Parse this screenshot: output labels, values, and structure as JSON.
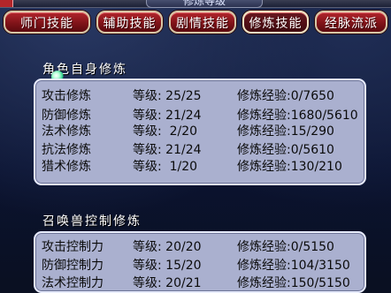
{
  "window": {
    "title": "修炼等级"
  },
  "tabs": [
    {
      "label": "师门技能",
      "active": false
    },
    {
      "label": "辅助技能",
      "active": false
    },
    {
      "label": "剧情技能",
      "active": false
    },
    {
      "label": "修炼技能",
      "active": true
    },
    {
      "label": "经脉流派",
      "active": false
    }
  ],
  "sections": [
    {
      "title": "角色自身修炼",
      "rows": [
        {
          "name": "攻击修炼",
          "level": "等级: 25/25",
          "exp": "修炼经验:0/7650"
        },
        {
          "name": "防御修炼",
          "level": "等级: 21/24",
          "exp": "修炼经验:1680/5610"
        },
        {
          "name": "法术修炼",
          "level": "等级:  2/20",
          "exp": "修炼经验:15/290"
        },
        {
          "name": "抗法修炼",
          "level": "等级: 21/24",
          "exp": "修炼经验:0/5610"
        },
        {
          "name": "猎术修炼",
          "level": "等级:  1/20",
          "exp": "修炼经验:130/210"
        }
      ]
    },
    {
      "title": "召唤兽控制修炼",
      "rows": [
        {
          "name": "攻击控制力",
          "level": "等级: 20/20",
          "exp": "修炼经验:0/5150"
        },
        {
          "name": "防御控制力",
          "level": "等级: 15/20",
          "exp": "修炼经验:104/3150"
        },
        {
          "name": "法术控制力",
          "level": "等级: 20/21",
          "exp": "修炼经验:150/5150"
        }
      ]
    }
  ],
  "colors": {
    "tab_bg": "#9a1a20",
    "tab_border": "#d8c7a6",
    "panel_bg": "#aab0cf",
    "panel_border": "#e7ebff",
    "section_title": "#ffffff"
  }
}
